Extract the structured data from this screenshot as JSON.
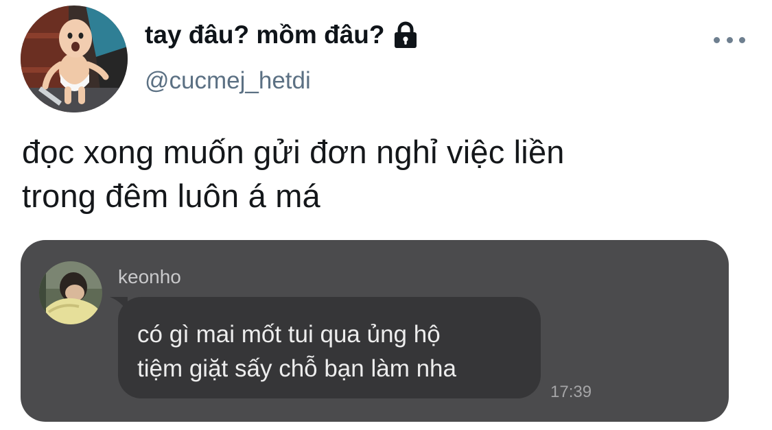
{
  "tweet": {
    "display_name": "tay đâu? mồm đâu?",
    "handle": "@cucmej_hetdi",
    "text_lines": [
      "đọc xong muốn gửi đơn nghỉ việc liền",
      "trong đêm luôn á má"
    ],
    "icons": {
      "lock": "lock-icon",
      "more": "more-options-icon"
    }
  },
  "chat": {
    "sender": "keonho",
    "message_lines": [
      "có gì mai mốt tui qua ủng hộ",
      "tiệm giặt sấy chỗ bạn làm nha"
    ],
    "time": "17:39"
  },
  "colors": {
    "name": "#0f1419",
    "handle": "#5b7083",
    "chat_background": "#4b4b4d",
    "bubble_background": "#363638",
    "bubble_text": "#ededed"
  }
}
